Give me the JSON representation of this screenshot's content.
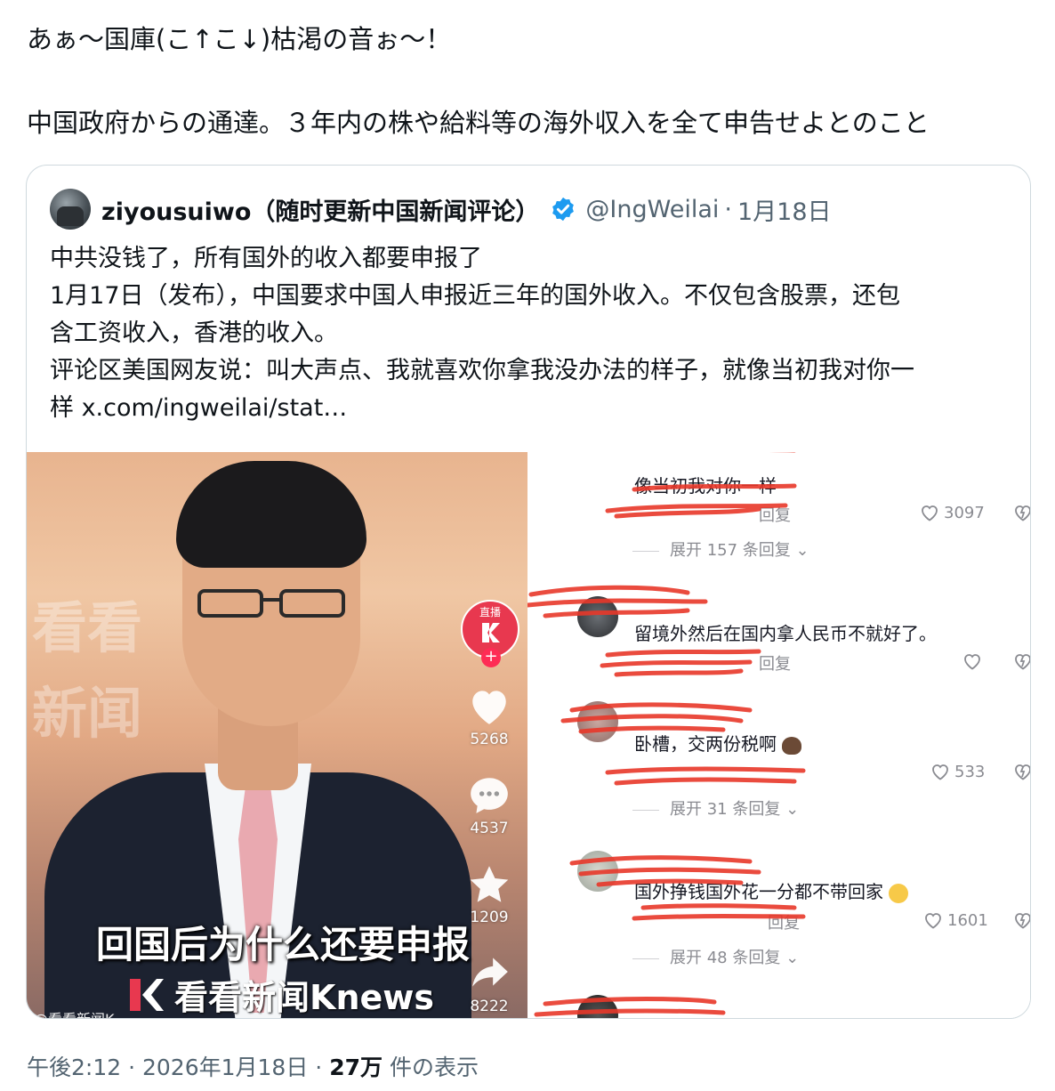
{
  "tweet": {
    "line1": "あぁ〜国庫(こ↑こ↓)枯渇の音ぉ〜！",
    "line2": "中国政府からの通達。３年内の株や給料等の海外収入を全て申告せよとのこと"
  },
  "quote": {
    "name": "ziyousuiwo（随时更新中国新闻评论）",
    "handle": "@IngWeilai",
    "separator": "·",
    "date": "1月18日",
    "body": [
      "中共没钱了，所有国外的收入都要申报了",
      "1月17日（发布），中国要求中国人申报近三年的国外收入。不仅包含股票，还包",
      "含工资收入，香港的收入。",
      "评论区美国网友说：叫大声点、我就喜欢你拿我没办法的样子，就像当初我对你一",
      "样  x.com/ingweilai/stat…"
    ]
  },
  "video": {
    "bg_text_1": "看看",
    "bg_text_2": "新闻",
    "caption": "回国后为什么还要申报",
    "logo_text": "看看新闻Knews",
    "live_label": "直播",
    "handle": "@看看新闻K",
    "likes": "5268",
    "comments": "4537",
    "favorites": "1209",
    "shares": "8222"
  },
  "comments": {
    "c0_text": "像当初我对你一样",
    "c0_reply": "回复",
    "c0_likes": "3097",
    "c0_expand": "展开 157 条回复",
    "c1_text": "留境外然后在国内拿人民币不就好了。",
    "c1_reply": "回复",
    "c2_text": "卧槽，交两份税啊",
    "c2_likes": "533",
    "c2_expand": "展开 31 条回复",
    "c3_text": "国外挣钱国外花一分都不带回家",
    "c3_reply": "回复",
    "c3_likes": "1601",
    "c3_expand": "展开 48 条回复"
  },
  "footer": {
    "time": "午後2:12",
    "sep1": "·",
    "date": "2026年1月18日",
    "sep2": "·",
    "views": "27万",
    "views_label": "件の表示"
  },
  "colors": {
    "link_gray": "#536471",
    "verified_blue": "#1d9bf0",
    "scribble_red": "#e8382a",
    "border": "#cfd9de"
  }
}
